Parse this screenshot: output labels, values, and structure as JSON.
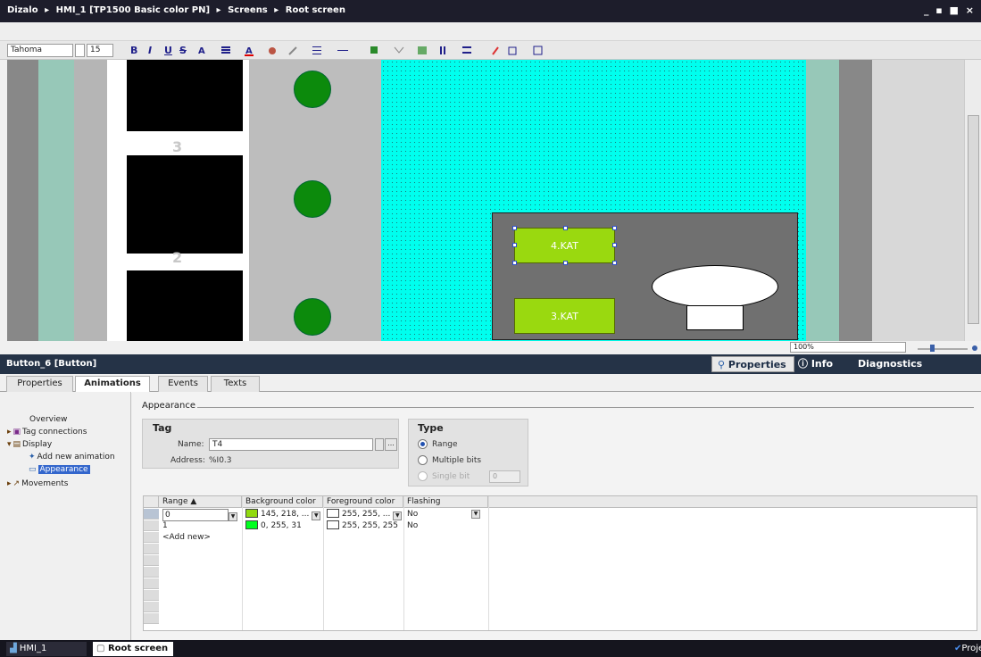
{
  "title_bar": {
    "crumbs": [
      "Dizalo",
      "HMI_1 [TP1500 Basic color PN]",
      "Screens",
      "Root screen"
    ],
    "separator": "▸",
    "window_controls": "_ ▪ ■ ×"
  },
  "format_toolbar": {
    "font": "Tahoma",
    "size": "15",
    "bold": "B",
    "italic": "I",
    "underline": "U",
    "strike": "S"
  },
  "canvas": {
    "numbers": [
      "3",
      "2"
    ],
    "buttons": [
      {
        "label": "4.KAT",
        "selected": true
      },
      {
        "label": "3.KAT",
        "selected": false
      }
    ],
    "colors": {
      "grid_area": "#00ffee",
      "lamp": "#0c8a0c",
      "button_bg": "#9ad90f",
      "panel": "#707070"
    }
  },
  "zoom": {
    "value": "100%"
  },
  "inspector": {
    "object": "Button_6 [Button]",
    "tabs": {
      "properties": "Properties",
      "info": "Info",
      "diagnostics": "Diagnostics"
    },
    "subtabs": [
      "Properties",
      "Animations",
      "Events",
      "Texts"
    ],
    "active_subtab": "Animations",
    "nav": {
      "overview": "Overview",
      "tag_connections": "Tag connections",
      "display": "Display",
      "add_new_animation": "Add new animation",
      "appearance": "Appearance",
      "movements": "Movements"
    },
    "appearance": {
      "heading": "Appearance",
      "tag": {
        "title": "Tag",
        "name_label": "Name:",
        "name_value": "T4",
        "address_label": "Address:",
        "address_value": "%I0.3"
      },
      "type": {
        "title": "Type",
        "range": "Range",
        "multiple_bits": "Multiple bits",
        "single_bit": "Single bit",
        "single_bit_value": "0",
        "selected": "Range"
      },
      "grid": {
        "columns": [
          "Range ▲",
          "Background color",
          "Foreground color",
          "Flashing"
        ],
        "rows": [
          {
            "range": "0",
            "background": "145, 218, ...",
            "background_hex": "#91da0f",
            "foreground": "255, 255, ...",
            "foreground_hex": "#ffffff",
            "flashing": "No"
          },
          {
            "range": "1",
            "background": "0, 255, 31",
            "background_hex": "#00ff1f",
            "foreground": "255, 255, 255",
            "foreground_hex": "#ffffff",
            "flashing": "No"
          }
        ],
        "add_new": "<Add new>"
      }
    }
  },
  "status_bar": {
    "items": [
      "HMI_1",
      "Root screen"
    ],
    "right": "Proje"
  }
}
